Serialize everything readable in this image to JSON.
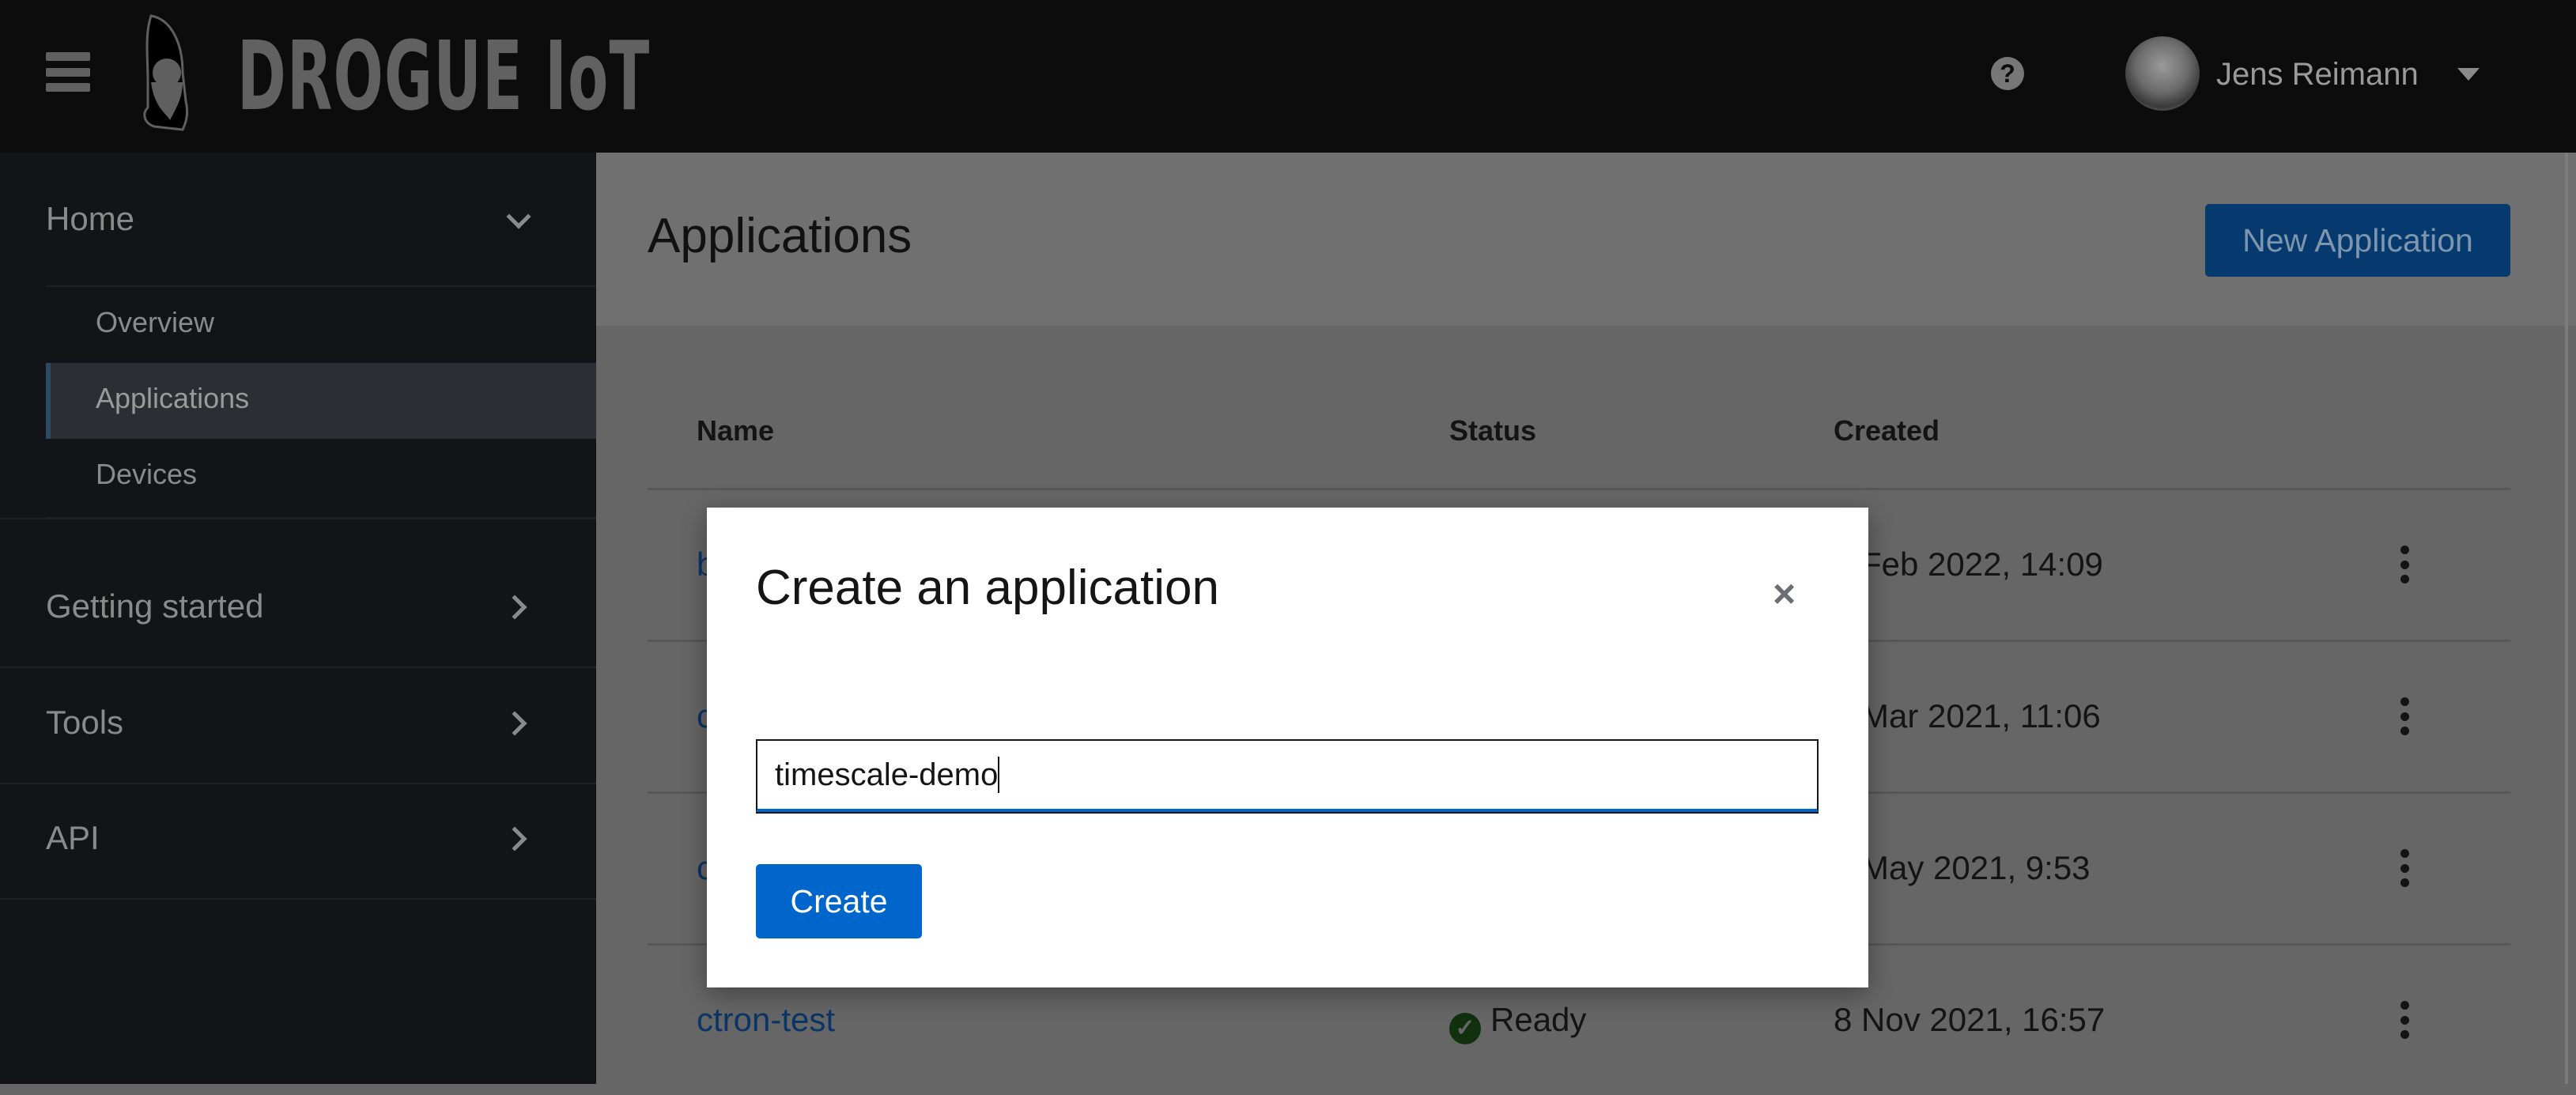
{
  "header": {
    "brand": "DROGUE IoT",
    "user_name": "Jens Reimann",
    "icons": [
      "menu-icon",
      "gnome-logo",
      "help-icon",
      "avatar",
      "caret-down-icon"
    ]
  },
  "sidebar": {
    "home": {
      "label": "Home",
      "items": [
        {
          "label": "Overview"
        },
        {
          "label": "Applications",
          "active": true
        },
        {
          "label": "Devices"
        }
      ]
    },
    "sections": [
      {
        "label": "Getting started"
      },
      {
        "label": "Tools"
      },
      {
        "label": "API"
      }
    ]
  },
  "page": {
    "title": "Applications",
    "new_button": "New Application"
  },
  "table": {
    "columns": [
      "Name",
      "Status",
      "Created"
    ],
    "rows": [
      {
        "name": "b",
        "status": "",
        "created": "Feb 2022, 14:09"
      },
      {
        "name": "c",
        "status": "",
        "created": "Mar 2021, 11:06"
      },
      {
        "name": "c",
        "status": "",
        "created": "May 2021, 9:53"
      },
      {
        "name": "ctron-test",
        "status": "Ready",
        "created": "8 Nov 2021, 16:57"
      }
    ]
  },
  "modal": {
    "title": "Create an application",
    "close": "×",
    "input_value": "timescale-demo",
    "create_button": "Create"
  },
  "colors": {
    "primary": "#0066cc",
    "link": "#0066cc",
    "success": "#3e8635"
  }
}
